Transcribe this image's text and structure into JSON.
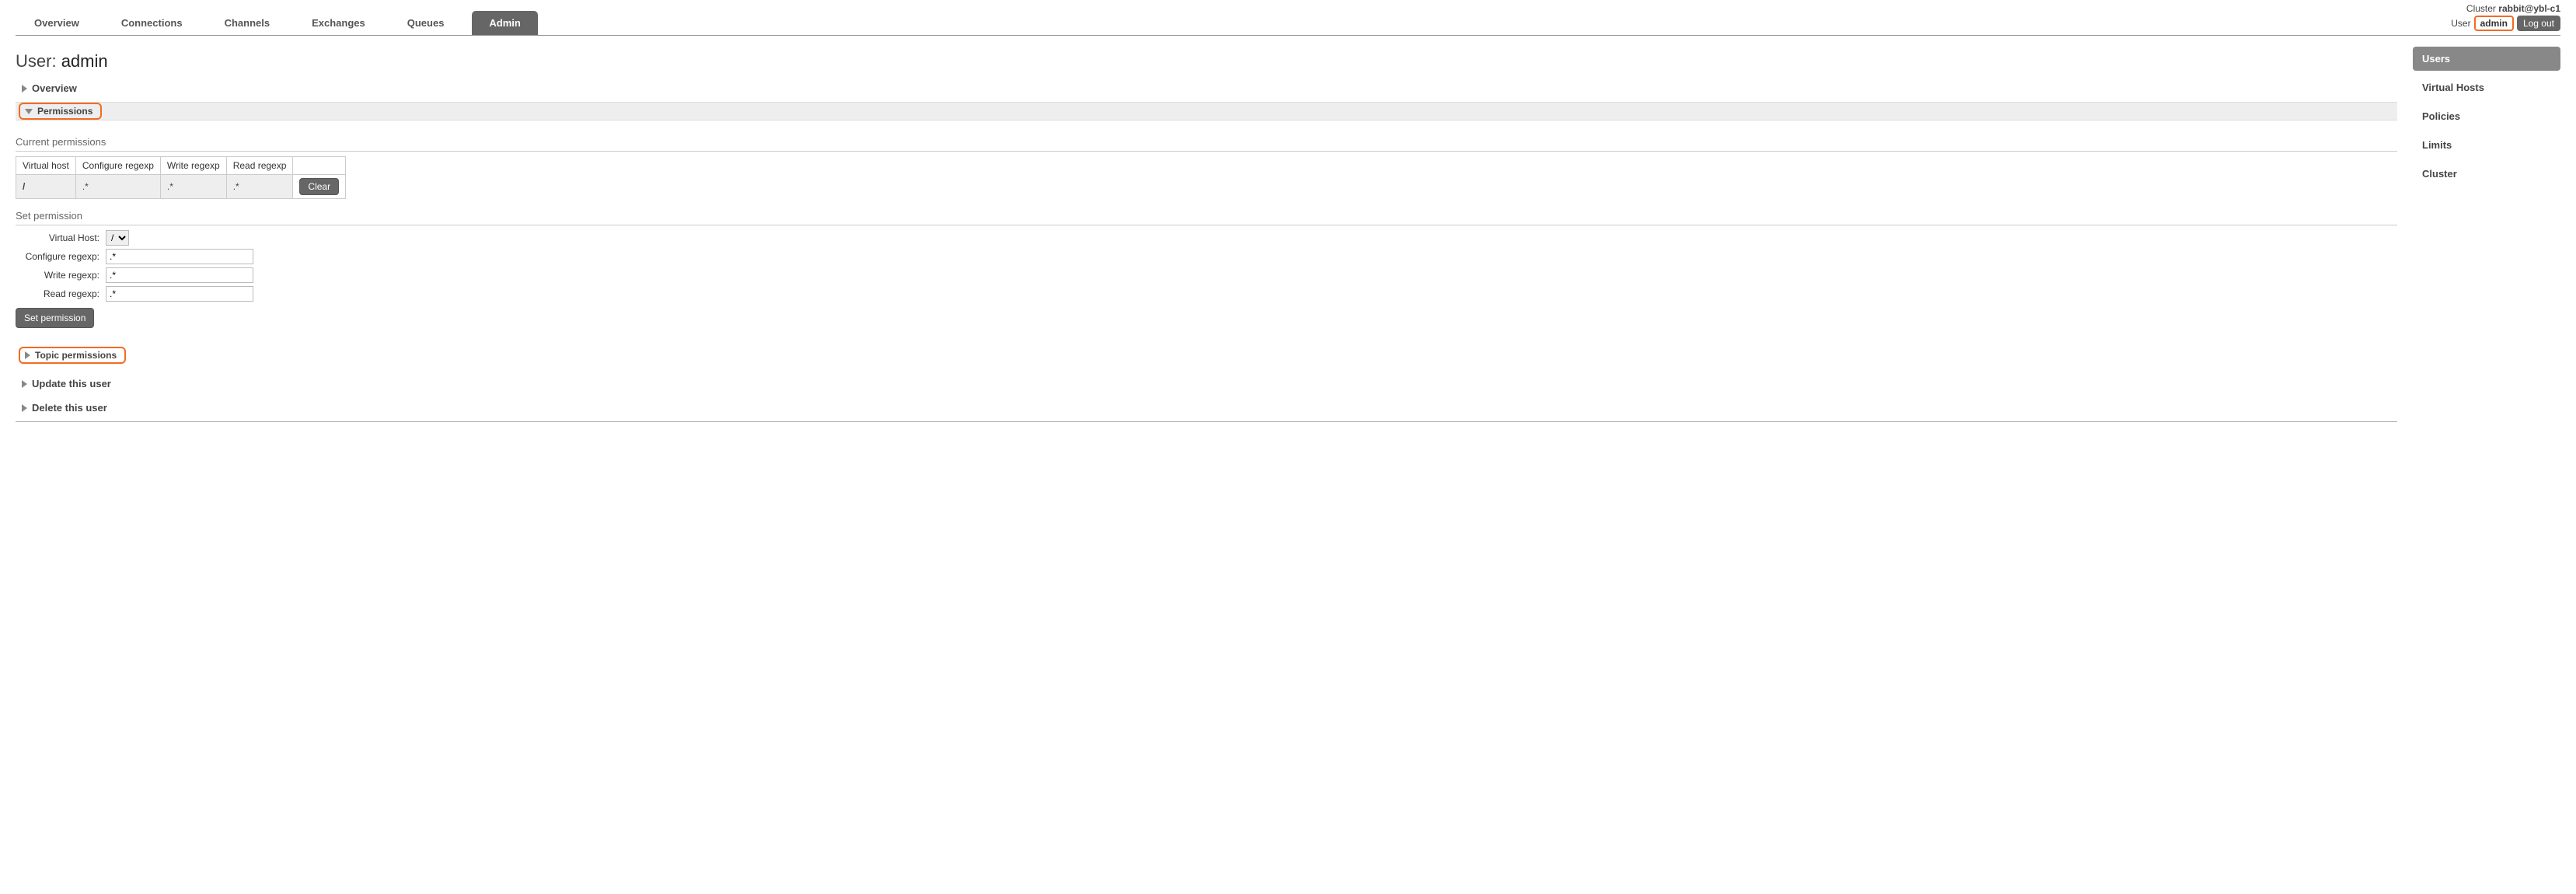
{
  "header": {
    "cluster_label": "Cluster",
    "cluster_name": "rabbit@ybl-c1",
    "user_label": "User",
    "current_user": "admin",
    "logout_label": "Log out"
  },
  "tabs": {
    "overview": "Overview",
    "connections": "Connections",
    "channels": "Channels",
    "exchanges": "Exchanges",
    "queues": "Queues",
    "admin": "Admin"
  },
  "page": {
    "title_prefix": "User: ",
    "title_user": "admin"
  },
  "sections": {
    "overview": "Overview",
    "permissions": "Permissions",
    "topic_permissions": "Topic permissions",
    "update_user": "Update this user",
    "delete_user": "Delete this user"
  },
  "permissions": {
    "current_heading": "Current permissions",
    "columns": {
      "vhost": "Virtual host",
      "configure": "Configure regexp",
      "write": "Write regexp",
      "read": "Read regexp"
    },
    "rows": [
      {
        "vhost": "/",
        "configure": ".*",
        "write": ".*",
        "read": ".*"
      }
    ],
    "clear_label": "Clear",
    "set_heading": "Set permission",
    "form": {
      "vhost_label": "Virtual Host:",
      "vhost_value": "/",
      "configure_label": "Configure regexp:",
      "configure_value": ".*",
      "write_label": "Write regexp:",
      "write_value": ".*",
      "read_label": "Read regexp:",
      "read_value": ".*",
      "submit_label": "Set permission"
    }
  },
  "sidebar": {
    "users": "Users",
    "vhosts": "Virtual Hosts",
    "policies": "Policies",
    "limits": "Limits",
    "cluster": "Cluster"
  }
}
